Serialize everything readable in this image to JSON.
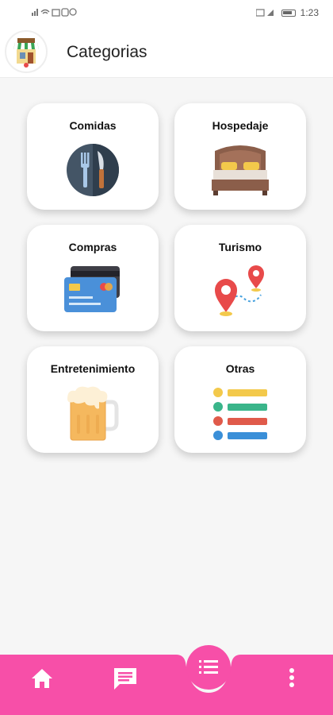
{
  "status_bar": {
    "time": "1:23"
  },
  "app_bar": {
    "title": "Categorias"
  },
  "categories": [
    {
      "label": "Comidas",
      "icon": "fork-knife-icon"
    },
    {
      "label": "Hospedaje",
      "icon": "bed-icon"
    },
    {
      "label": "Compras",
      "icon": "credit-card-icon"
    },
    {
      "label": "Turismo",
      "icon": "map-route-icon"
    },
    {
      "label": "Entretenimiento",
      "icon": "beer-mug-icon"
    },
    {
      "label": "Otras",
      "icon": "list-icon"
    }
  ],
  "bottom_nav": {
    "items": [
      "home-icon",
      "chat-icon",
      "list-fab-icon",
      "more-vert-icon"
    ]
  },
  "colors": {
    "accent": "#f74fa8",
    "background": "#f6f6f6"
  }
}
